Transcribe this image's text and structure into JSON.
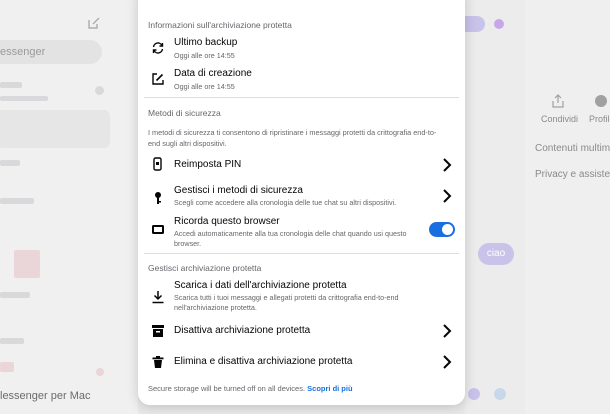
{
  "background": {
    "search_placeholder": "essenger",
    "footer_text": "lessenger per Mac",
    "chat_bubble": "ciao",
    "side_labels": [
      "Condividi",
      "Profilo"
    ],
    "right_items": [
      "Contenuti multim",
      "Privacy e assisten"
    ]
  },
  "modal": {
    "section_info": {
      "title": "Informazioni sull'archiviazione protetta",
      "last_backup": {
        "title": "Ultimo backup",
        "sub": "Oggi alle ore 14:55"
      },
      "creation_date": {
        "title": "Data di creazione",
        "sub": "Oggi alle ore 14:55"
      }
    },
    "section_security": {
      "title": "Metodi di sicurezza",
      "description": "I metodi di sicurezza ti consentono di ripristinare i messaggi protetti da crittografia end-to-end sugli altri dispositivi.",
      "reset_pin": {
        "title": "Reimposta PIN"
      },
      "manage_methods": {
        "title": "Gestisci i metodi di sicurezza",
        "sub": "Scegli come accedere alla cronologia delle tue chat su altri dispositivi."
      },
      "remember_browser": {
        "title": "Ricorda questo browser",
        "sub": "Accedi automaticamente alla tua cronologia delle chat quando usi questo browser.",
        "enabled": true
      }
    },
    "section_manage": {
      "title": "Gestisci archiviazione protetta",
      "download": {
        "title": "Scarica i dati dell'archiviazione protetta",
        "sub": "Scarica tutti i tuoi messaggi e allegati protetti da crittografia end-to-end nell'archiviazione protetta."
      },
      "disable": {
        "title": "Disattiva archiviazione protetta"
      },
      "delete": {
        "title": "Elimina e disattiva archiviazione protetta"
      }
    },
    "footer": {
      "text": "Secure storage will be turned off on all devices.",
      "link": "Scopri di più"
    }
  },
  "colors": {
    "accent": "#1a6fe0",
    "text": "#050505",
    "secondary": "#65676b"
  }
}
